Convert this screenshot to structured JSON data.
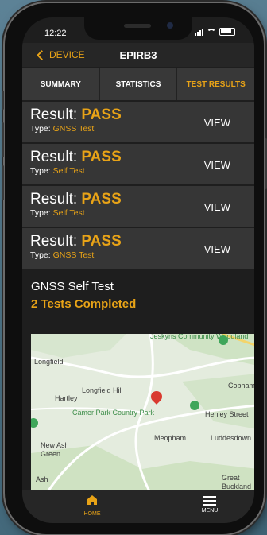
{
  "status_bar": {
    "time": "12:22"
  },
  "nav": {
    "back_label": "DEVICE",
    "title": "EPIRB3"
  },
  "tabs": [
    {
      "label": "SUMMARY",
      "active": false
    },
    {
      "label": "STATISTICS",
      "active": false
    },
    {
      "label": "TEST RESULTS",
      "active": true
    }
  ],
  "results": [
    {
      "result_label": "Result:",
      "result_value": "PASS",
      "type_label": "Type:",
      "type_value": "GNSS Test",
      "view_label": "VIEW"
    },
    {
      "result_label": "Result:",
      "result_value": "PASS",
      "type_label": "Type:",
      "type_value": "Self Test",
      "view_label": "VIEW"
    },
    {
      "result_label": "Result:",
      "result_value": "PASS",
      "type_label": "Type:",
      "type_value": "Self Test",
      "view_label": "VIEW"
    },
    {
      "result_label": "Result:",
      "result_value": "PASS",
      "type_label": "Type:",
      "type_value": "GNSS Test",
      "view_label": "VIEW"
    }
  ],
  "summary": {
    "heading": "GNSS Self Test",
    "tests_completed": "2 Tests Completed"
  },
  "map": {
    "places": [
      "Jeskyns Community Woodland",
      "Longfield",
      "Cobham",
      "Longfield Hill",
      "Hartley",
      "Camer Park Country Park",
      "Henley Street",
      "Meopham",
      "Luddesdown",
      "New Ash Green",
      "Ash",
      "Great Buckland"
    ]
  },
  "tabbar": {
    "home_label": "HOME",
    "menu_label": "MENU"
  },
  "colors": {
    "accent": "#e8a317",
    "row_bg": "#363636",
    "screen_bg": "#1e1e1e"
  },
  "icons": [
    "chevron-left-icon",
    "signal-icon",
    "wifi-icon",
    "battery-icon",
    "home-icon",
    "menu-icon",
    "map-pin-icon"
  ]
}
